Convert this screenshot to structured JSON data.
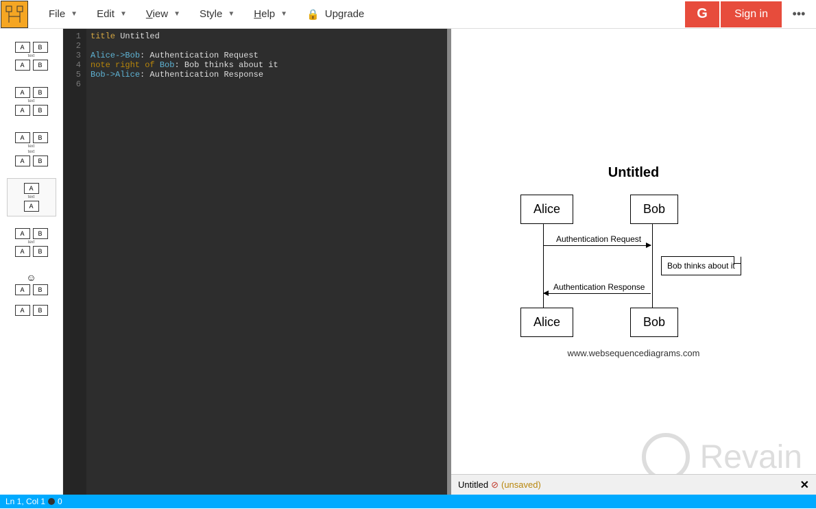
{
  "menu": {
    "file": "File",
    "edit": "Edit",
    "view": "View",
    "style": "Style",
    "help": "Help",
    "upgrade": "Upgrade"
  },
  "auth": {
    "google": "G",
    "signin": "Sign in"
  },
  "editor": {
    "lines": [
      "1",
      "2",
      "3",
      "4",
      "5",
      "6"
    ],
    "code": {
      "l1_kw": "title",
      "l1_str": " Untitled",
      "l3_a": "Alice",
      "l3_arrow": "->",
      "l3_b": "Bob",
      "l3_rest": ": Authentication Request",
      "l4_kw": "note right of ",
      "l4_actor": "Bob",
      "l4_rest": ": Bob thinks about it",
      "l5_a": "Bob",
      "l5_arrow": "->",
      "l5_b": "Alice",
      "l5_rest": ": Authentication Response"
    }
  },
  "diagram": {
    "title": "Untitled",
    "actor_a": "Alice",
    "actor_b": "Bob",
    "msg1": "Authentication Request",
    "note": "Bob thinks about it",
    "msg2": "Authentication Response",
    "url": "www.websequencediagrams.com"
  },
  "watermark": "Revain",
  "preview_status": {
    "title": "Untitled",
    "unsaved": "(unsaved)"
  },
  "bottom": {
    "pos": "Ln 1, Col 1",
    "count": "0"
  }
}
